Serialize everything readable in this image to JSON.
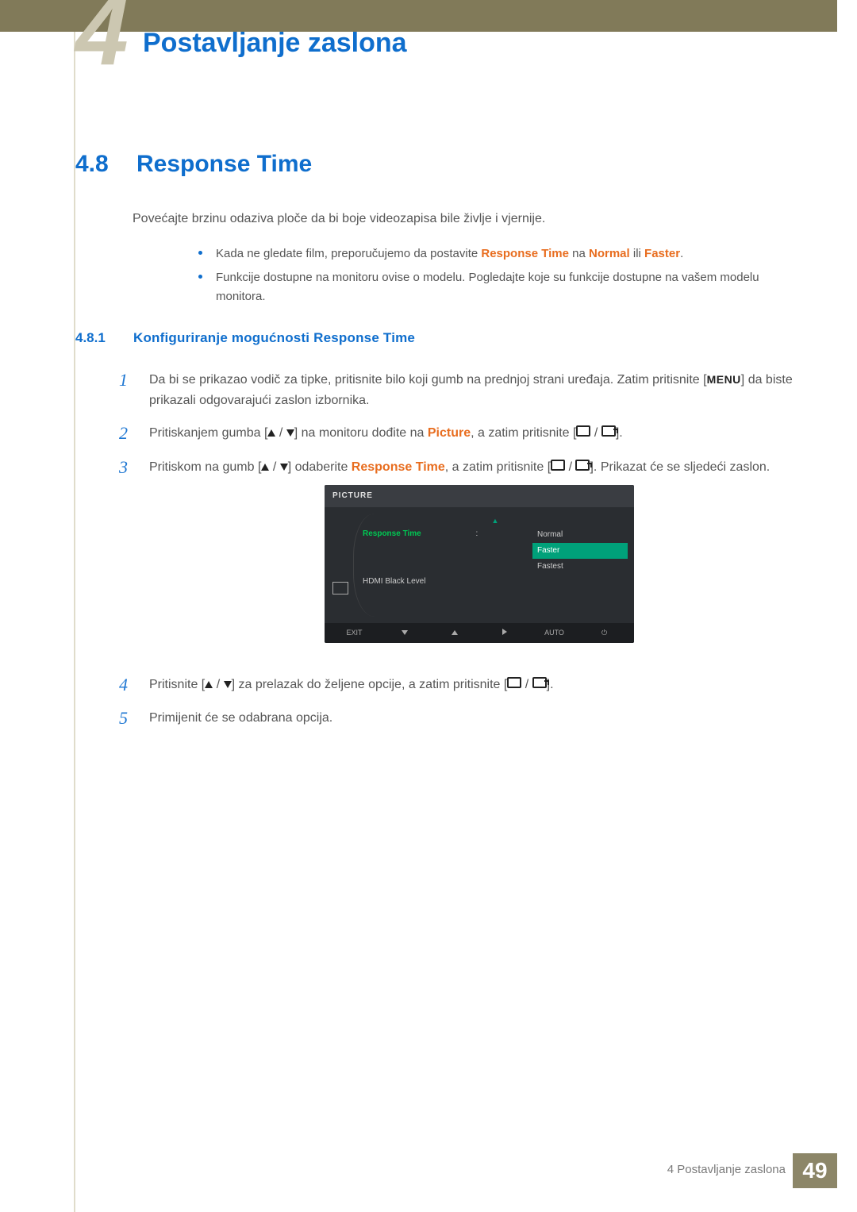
{
  "chapter": {
    "number": "4",
    "title": "Postavljanje zaslona"
  },
  "section": {
    "number": "4.8",
    "title": "Response Time"
  },
  "intro": "Povećajte brzinu odaziva ploče da bi boje videozapisa bile življe i vjernije.",
  "notes": {
    "n1_a": "Kada ne gledate film, preporučujemo da postavite ",
    "n1_b": "Response Time",
    "n1_c": " na ",
    "n1_d": "Normal",
    "n1_e": " ili ",
    "n1_f": "Faster",
    "n1_g": ".",
    "n2": "Funkcije dostupne na monitoru ovise o modelu. Pogledajte koje su funkcije dostupne na vašem modelu monitora."
  },
  "subsection": {
    "number": "4.8.1",
    "title": "Konfiguriranje mogućnosti Response Time"
  },
  "steps": {
    "s1a": "Da bi se prikazao vodič za tipke, pritisnite bilo koji gumb na prednjoj strani uređaja. Zatim pritisnite [",
    "s1menu": "MENU",
    "s1b": "] da biste prikazali odgovarajući zaslon izbornika.",
    "s2a": "Pritiskanjem gumba [",
    "s2b": "] na monitoru dođite na ",
    "s2pic": "Picture",
    "s2c": ", a zatim pritisnite [",
    "s2d": "].",
    "s3a": "Pritiskom na gumb [",
    "s3b": "] odaberite ",
    "s3rt": "Response Time",
    "s3c": ", a zatim pritisnite [",
    "s3d": "]. Prikazat će se sljedeći zaslon.",
    "s4a": "Pritisnite [",
    "s4b": "] za prelazak do željene opcije, a zatim pritisnite [",
    "s4c": "].",
    "s5": "Primijenit će se odabrana opcija."
  },
  "step_numbers": {
    "n1": "1",
    "n2": "2",
    "n3": "3",
    "n4": "4",
    "n5": "5"
  },
  "osd": {
    "header": "PICTURE",
    "item1": "Response Time",
    "item2": "HDMI Black Level",
    "opt1": "Normal",
    "opt2": "Faster",
    "opt3": "Fastest",
    "bar": {
      "exit": "EXIT",
      "auto": "AUTO"
    }
  },
  "footer": {
    "text": "4 Postavljanje zaslona",
    "page": "49"
  }
}
